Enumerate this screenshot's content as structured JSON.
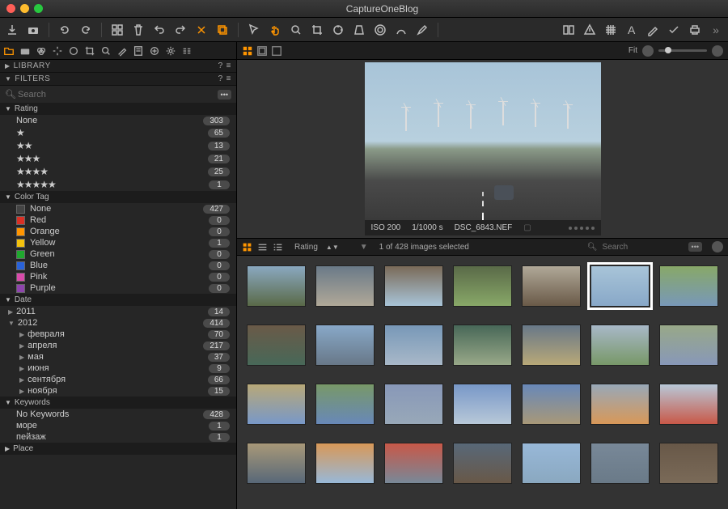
{
  "title": "CaptureOneBlog",
  "panels": {
    "library": "LIBRARY",
    "filters": "FILTERS"
  },
  "search_placeholder": "Search",
  "fit_label": "Fit",
  "rating": {
    "title": "Rating",
    "none_label": "None",
    "counts": [
      303,
      65,
      13,
      21,
      25,
      1
    ]
  },
  "color_tag": {
    "title": "Color Tag",
    "items": [
      {
        "label": "None",
        "color": "#444",
        "count": 427
      },
      {
        "label": "Red",
        "color": "#d93025",
        "count": 0
      },
      {
        "label": "Orange",
        "color": "#ff9500",
        "count": 0
      },
      {
        "label": "Yellow",
        "color": "#f4c20d",
        "count": 1
      },
      {
        "label": "Green",
        "color": "#1fa82e",
        "count": 0
      },
      {
        "label": "Blue",
        "color": "#2962d9",
        "count": 0
      },
      {
        "label": "Pink",
        "color": "#d94baa",
        "count": 0
      },
      {
        "label": "Purple",
        "color": "#8e44ad",
        "count": 0
      }
    ]
  },
  "date": {
    "title": "Date",
    "years": [
      {
        "label": "2011",
        "count": 14,
        "open": false
      },
      {
        "label": "2012",
        "count": 414,
        "open": true,
        "months": [
          {
            "label": "февраля",
            "count": 70
          },
          {
            "label": "апреля",
            "count": 217
          },
          {
            "label": "мая",
            "count": 37
          },
          {
            "label": "июня",
            "count": 9
          },
          {
            "label": "сентября",
            "count": 66
          },
          {
            "label": "ноября",
            "count": 15
          }
        ]
      }
    ]
  },
  "keywords": {
    "title": "Keywords",
    "items": [
      {
        "label": "No Keywords",
        "count": 428
      },
      {
        "label": "море",
        "count": 1
      },
      {
        "label": "пейзаж",
        "count": 1
      }
    ]
  },
  "place_title": "Place",
  "preview_meta": {
    "iso": "ISO 200",
    "shutter": "1/1000 s",
    "filename": "DSC_6843.NEF"
  },
  "browser": {
    "sort_by": "Rating",
    "selection": "1 of 428 images selected",
    "search_placeholder": "Search"
  },
  "thumb_count": 28,
  "selected_thumb_index": 5
}
